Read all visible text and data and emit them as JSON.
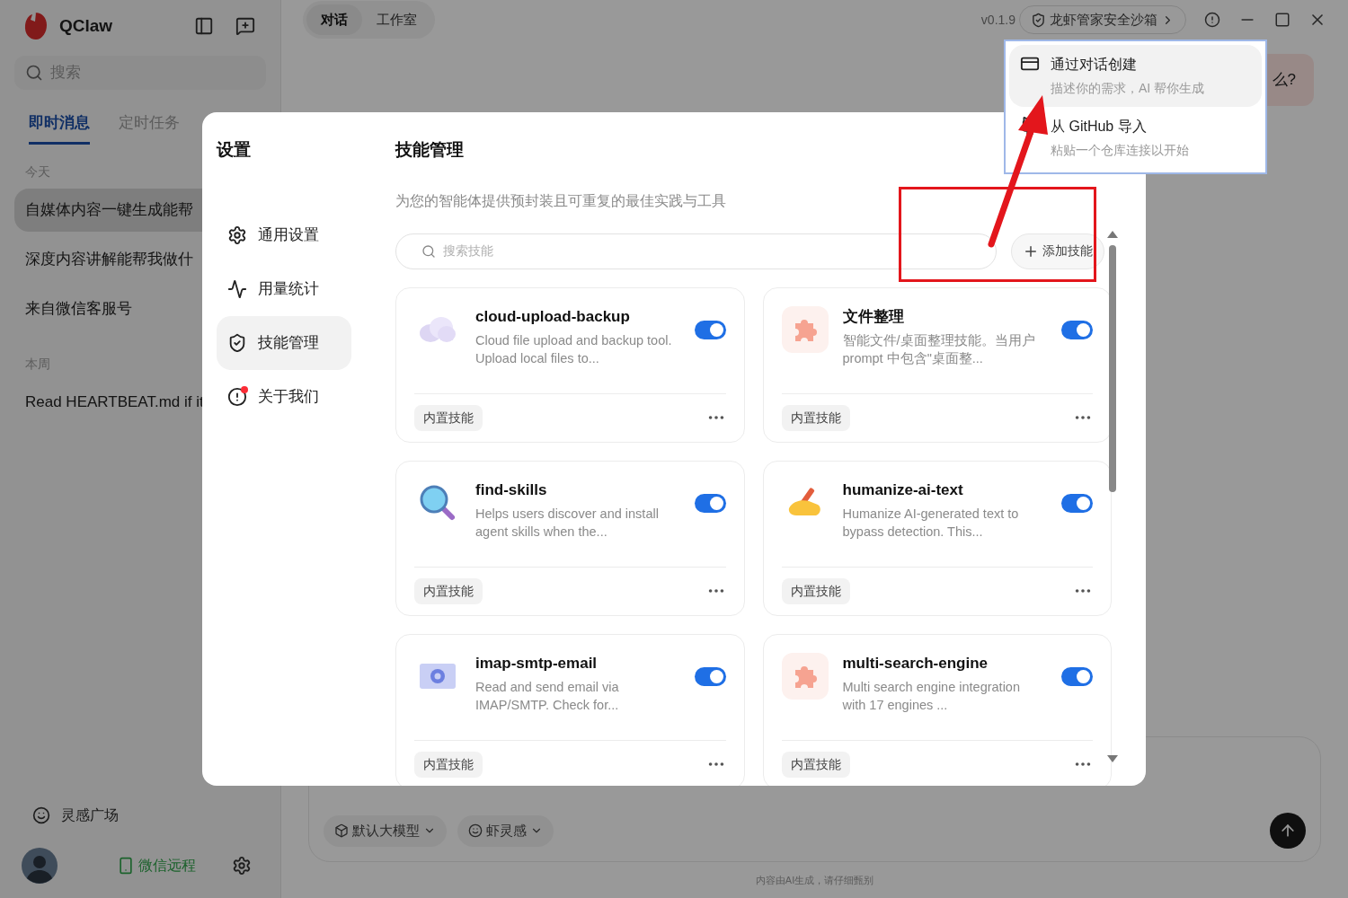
{
  "app": {
    "name": "QClaw"
  },
  "sidebar": {
    "search": {
      "placeholder": "搜索"
    },
    "tabs": [
      {
        "label": "即时消息",
        "selected": true
      },
      {
        "label": "定时任务",
        "selected": false
      }
    ],
    "sections": [
      {
        "heading": "今天",
        "items": [
          {
            "title": "自媒体内容一键生成能帮",
            "selected": true
          },
          {
            "title": "深度内容讲解能帮我做什",
            "selected": false
          },
          {
            "title": "来自微信客服号",
            "selected": false
          }
        ]
      },
      {
        "heading": "本周",
        "items": [
          {
            "title": "Read HEARTBEAT.md if it",
            "selected": false
          }
        ]
      }
    ],
    "inspiration": "灵感广场",
    "wechat": "微信远程"
  },
  "main": {
    "tabs": [
      {
        "label": "对话",
        "selected": true
      },
      {
        "label": "工作室",
        "selected": false
      }
    ],
    "version": "v0.1.9",
    "sandbox": "龙虾管家安全沙箱",
    "message_fragment": "么?",
    "chips": [
      "默认大模型",
      "虾灵感"
    ],
    "disclaimer": "内容由AI生成，请仔细甄别"
  },
  "settings": {
    "title": "设置",
    "nav": [
      {
        "label": "通用设置",
        "selected": false,
        "badge": false
      },
      {
        "label": "用量统计",
        "selected": false,
        "badge": false
      },
      {
        "label": "技能管理",
        "selected": true,
        "badge": false
      },
      {
        "label": "关于我们",
        "selected": false,
        "badge": true
      }
    ],
    "page": {
      "title": "技能管理",
      "subtitle": "为您的智能体提供预封装且可重复的最佳实践与工具",
      "search": {
        "placeholder": "搜索技能"
      },
      "add_button": "添加技能",
      "skills": [
        {
          "name": "cloud-upload-backup",
          "description": "Cloud file upload and backup tool. Upload local files to...",
          "on": true,
          "tag": "内置技能"
        },
        {
          "name": "文件整理",
          "description": "智能文件/桌面整理技能。当用户 prompt 中包含\"桌面整...",
          "on": true,
          "tag": "内置技能"
        },
        {
          "name": "find-skills",
          "description": "Helps users discover and install agent skills when the...",
          "on": true,
          "tag": "内置技能"
        },
        {
          "name": "humanize-ai-text",
          "description": "Humanize AI-generated text to bypass detection. This...",
          "on": true,
          "tag": "内置技能"
        },
        {
          "name": "imap-smtp-email",
          "description": "Read and send email via IMAP/SMTP. Check for...",
          "on": true,
          "tag": "内置技能"
        },
        {
          "name": "multi-search-engine",
          "description": "Multi search engine integration with 17 engines ...",
          "on": true,
          "tag": "内置技能"
        }
      ]
    }
  },
  "add_menu": {
    "items": [
      {
        "title": "通过对话创建",
        "subtitle": "描述你的需求，AI 帮你生成",
        "selected": true
      },
      {
        "title": "从 GitHub 导入",
        "subtitle": "粘贴一个仓库连接以开始",
        "selected": false
      }
    ]
  }
}
